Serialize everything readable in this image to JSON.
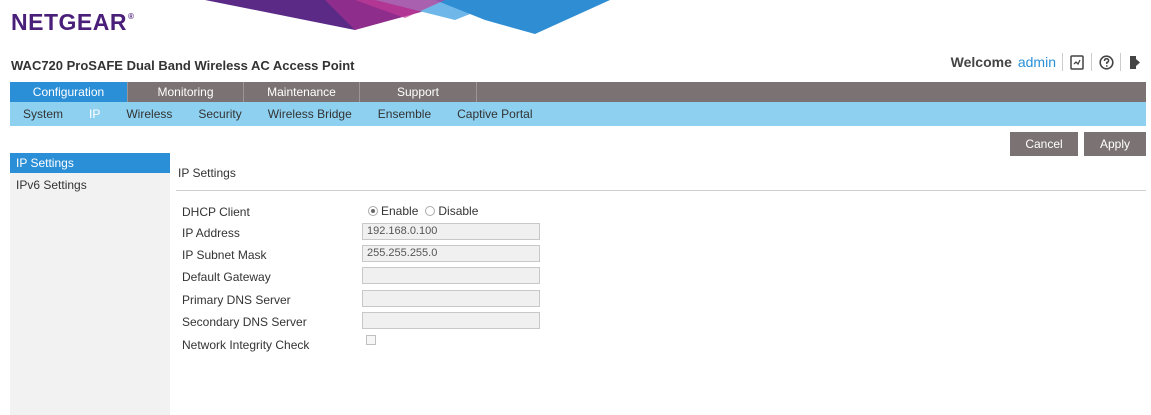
{
  "header": {
    "logo_text": "NETGEAR",
    "logo_mark": "®",
    "product_title": "WAC720 ProSAFE Dual Band Wireless AC Access Point",
    "welcome_text": "Welcome",
    "username": "admin",
    "icons": [
      "log-icon",
      "help-icon",
      "logout-icon"
    ]
  },
  "main_nav": {
    "tabs": [
      {
        "label": "Configuration",
        "active": true
      },
      {
        "label": "Monitoring",
        "active": false
      },
      {
        "label": "Maintenance",
        "active": false
      },
      {
        "label": "Support",
        "active": false
      }
    ]
  },
  "sub_nav": {
    "items": [
      {
        "label": "System",
        "active": false
      },
      {
        "label": "IP",
        "active": true
      },
      {
        "label": "Wireless",
        "active": false
      },
      {
        "label": "Security",
        "active": false
      },
      {
        "label": "Wireless Bridge",
        "active": false
      },
      {
        "label": "Ensemble",
        "active": false
      },
      {
        "label": "Captive Portal",
        "active": false
      }
    ]
  },
  "actions": {
    "cancel_label": "Cancel",
    "apply_label": "Apply"
  },
  "sidebar": {
    "items": [
      {
        "label": "IP Settings",
        "active": true
      },
      {
        "label": "IPv6 Settings",
        "active": false
      }
    ]
  },
  "section": {
    "title": "IP Settings"
  },
  "form": {
    "dhcp_label": "DHCP Client",
    "dhcp_enable_label": "Enable",
    "dhcp_disable_label": "Disable",
    "dhcp_selected": "Enable",
    "ip_address_label": "IP Address",
    "ip_address_value": "192.168.0.100",
    "subnet_label": "IP Subnet Mask",
    "subnet_value": "255.255.255.0",
    "gateway_label": "Default Gateway",
    "gateway_value": "",
    "primary_dns_label": "Primary DNS Server",
    "primary_dns_value": "",
    "secondary_dns_label": "Secondary DNS Server",
    "secondary_dns_value": "",
    "integrity_label": "Network Integrity Check",
    "integrity_checked": false
  },
  "colors": {
    "brand_purple": "#4a1f7a",
    "accent_blue": "#2a8fd6",
    "nav_gray": "#7b7373",
    "subnav_blue": "#8ed0f0"
  }
}
